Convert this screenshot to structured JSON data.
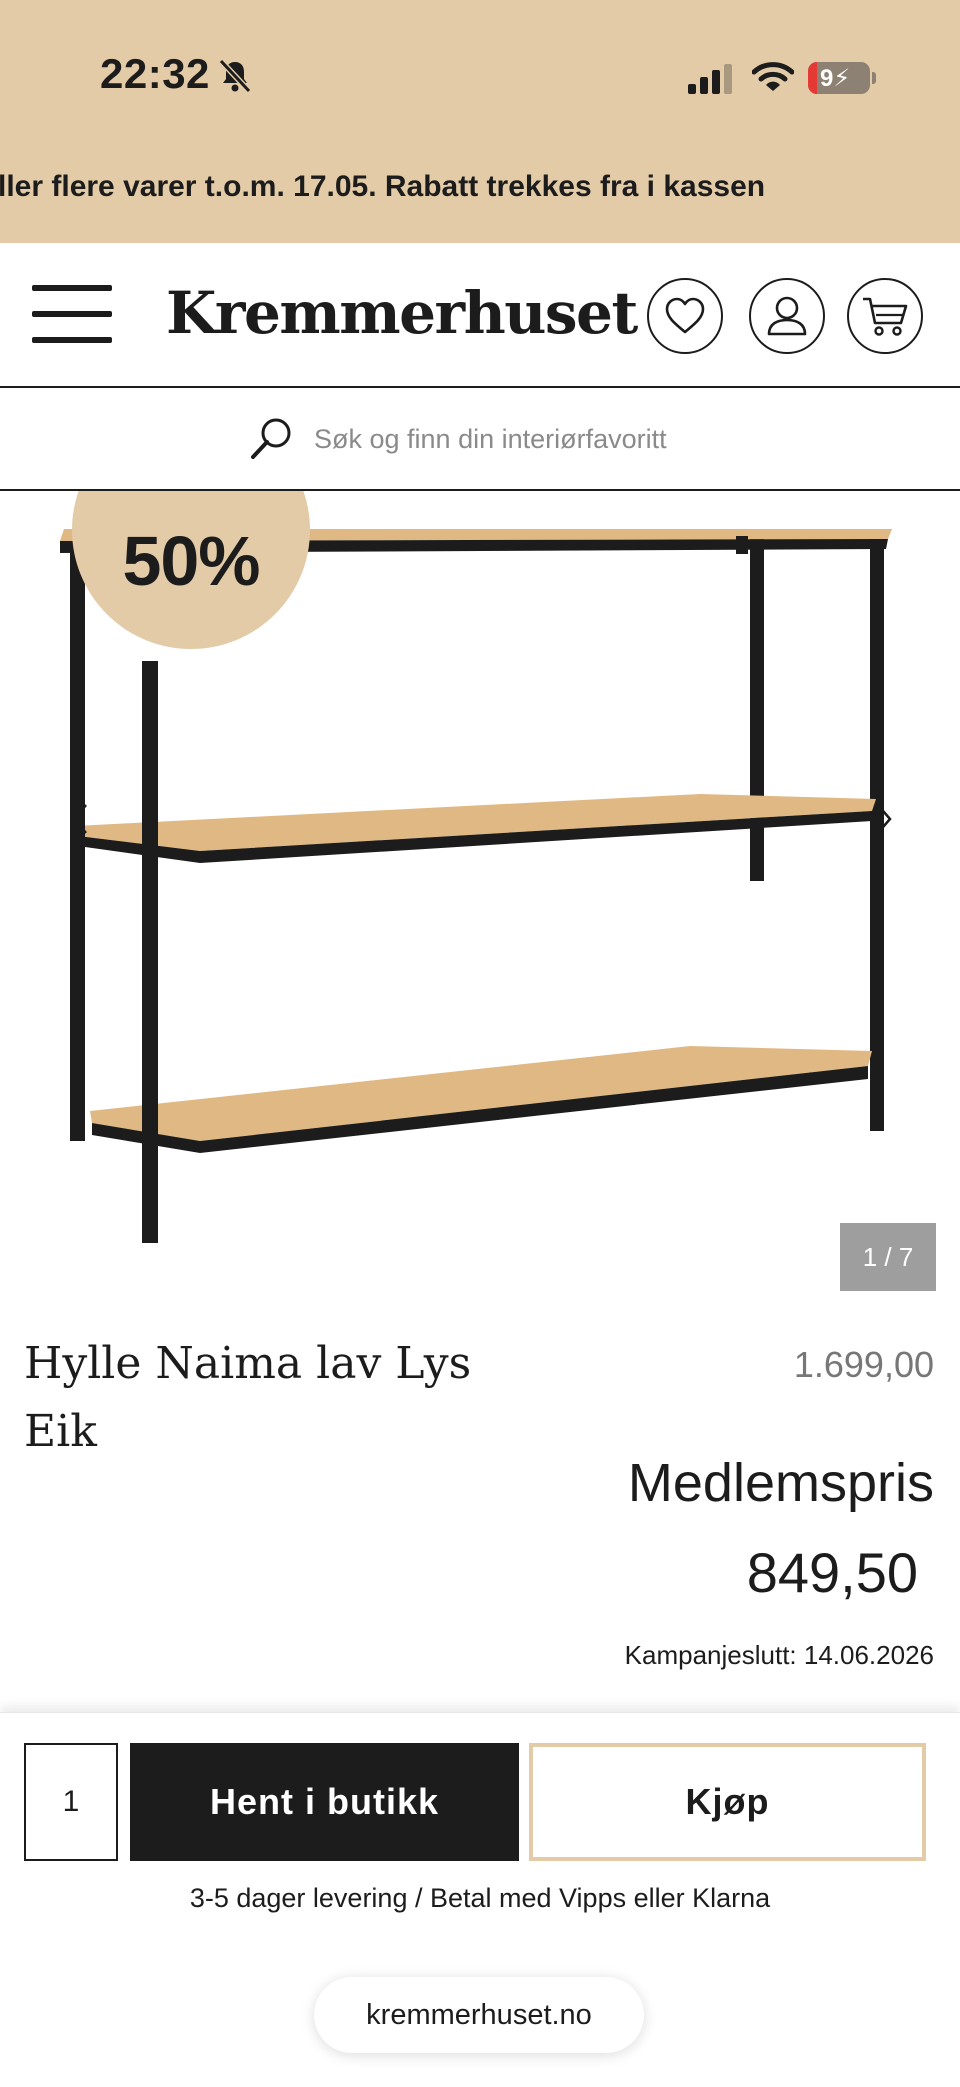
{
  "status_bar": {
    "time": "22:32",
    "battery": "9"
  },
  "promo_banner": {
    "text": "ller flere varer t.o.m. 17.05. Rabatt trekkes fra i kassen"
  },
  "header": {
    "logo": "Kremmerhuset",
    "icons": [
      "menu-icon",
      "heart-icon",
      "user-icon",
      "cart-icon"
    ]
  },
  "search": {
    "placeholder": "Søk og finn din interiørfavoritt"
  },
  "gallery": {
    "discount": "50%",
    "counter": "1 / 7"
  },
  "product": {
    "title": "Hylle Naima lav Lys Eik",
    "old_price": "1.699,00",
    "member_label": "Medlemspris",
    "member_price": "849,50",
    "campaign_end": "Kampanjeslutt: 14.06.2026"
  },
  "purchase": {
    "quantity": "1",
    "pickup_label": "Hent i butikk",
    "buy_label": "Kjøp",
    "delivery_text": "3-5 dager levering / Betal med Vipps eller Klarna"
  },
  "browser": {
    "url": "kremmerhuset.no"
  },
  "colors": {
    "accent": "#e3cba7",
    "dark": "#1c1c1c",
    "wood": "#e0b884"
  }
}
